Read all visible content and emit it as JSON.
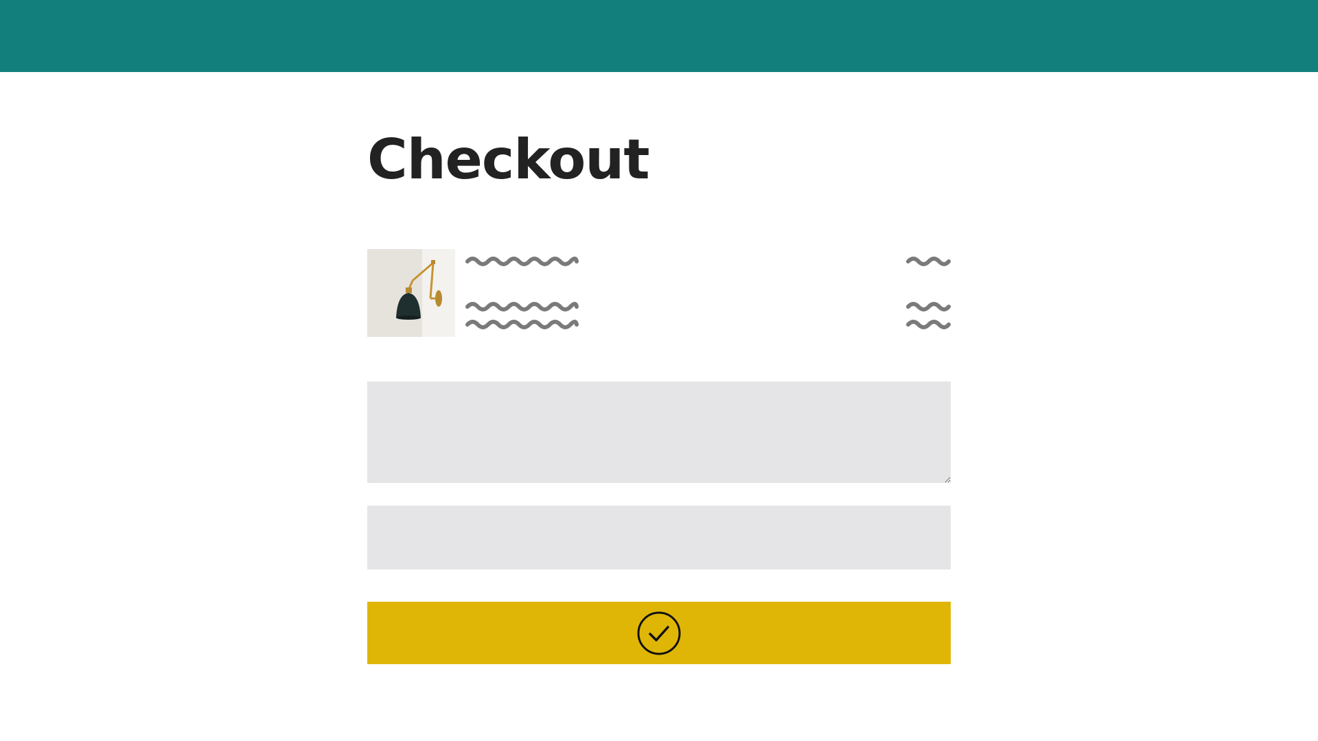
{
  "theme": {
    "header_color": "#127f7d",
    "field_color": "#e5e5e7",
    "button_color": "#e0b606",
    "text_color": "#222222",
    "placeholder_text_color": "#7a7a7a"
  },
  "page": {
    "title": "Checkout"
  },
  "cart": {
    "items": [
      {
        "image": "wall-sconce-lamp",
        "name_placeholder": "squiggle-text",
        "description_placeholder": "squiggle-text",
        "price_placeholder": "squiggle-text"
      }
    ]
  },
  "form": {
    "fields": [
      {
        "value": "",
        "placeholder": ""
      },
      {
        "value": "",
        "placeholder": ""
      }
    ]
  },
  "submit_button": {
    "icon": "check-circle-icon"
  }
}
